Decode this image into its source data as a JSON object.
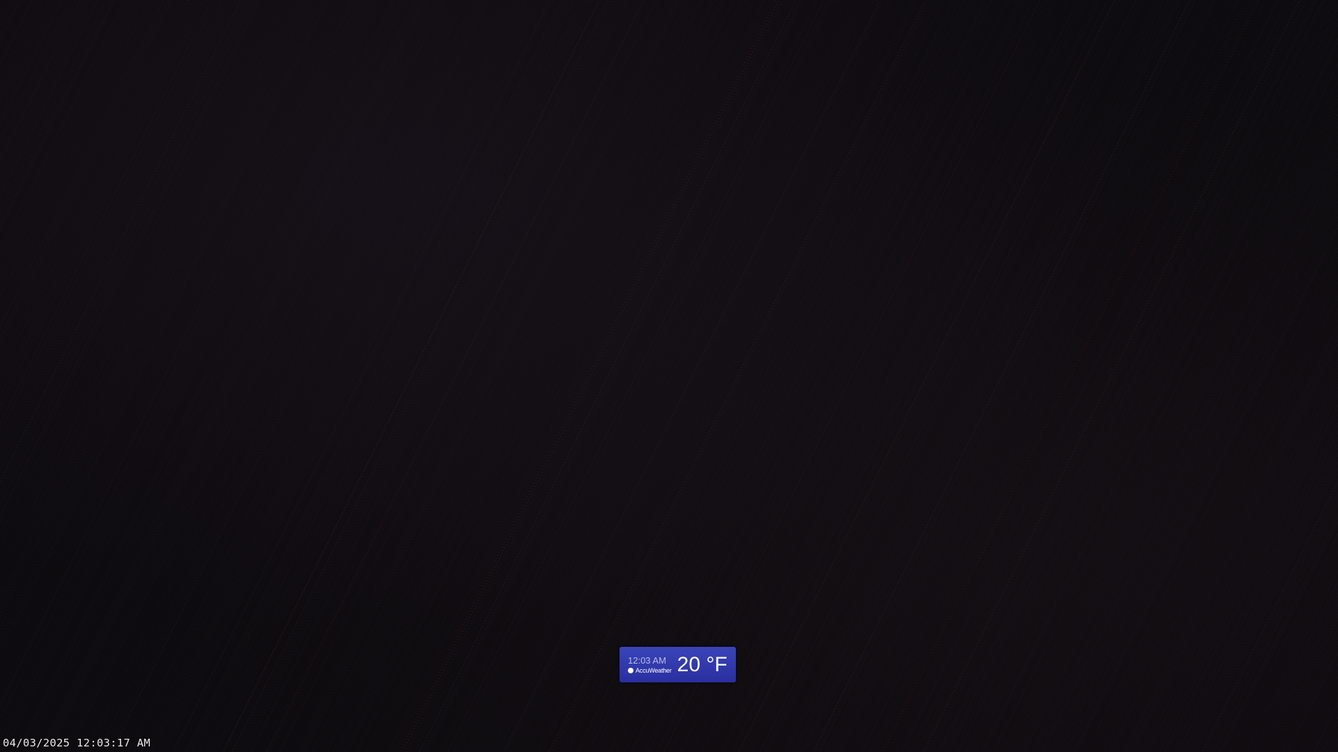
{
  "overlay": {
    "timestamp": "04/03/2025 12:03:17 AM"
  },
  "weather_widget": {
    "time": "12:03 AM",
    "brand": "AccuWeather",
    "brand_icon": "accuweather-sun-icon",
    "temperature": "20 °F",
    "background_color": "#3a44b8"
  },
  "scene": {
    "background_color": "#0d0b0e"
  }
}
